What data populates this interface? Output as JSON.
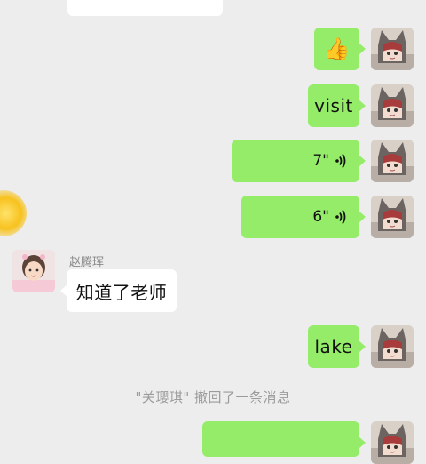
{
  "chat": {
    "messages": [
      {
        "type": "emoji",
        "emoji": "👍"
      },
      {
        "type": "text",
        "text": "visit"
      },
      {
        "type": "voice",
        "duration": "7\""
      },
      {
        "type": "voice",
        "duration": "6\""
      },
      {
        "type": "text",
        "text": "知道了老师",
        "sender": "赵腾珲"
      },
      {
        "type": "text",
        "text": "lake"
      }
    ],
    "system_notice": "\"关璎琪\" 撤回了一条消息"
  },
  "icons": {
    "voice": "voice-wave-icon",
    "floating": "floating-badge-icon"
  },
  "colors": {
    "my_bubble": "#95ec69",
    "other_bubble": "#ffffff",
    "background": "#ededed"
  }
}
